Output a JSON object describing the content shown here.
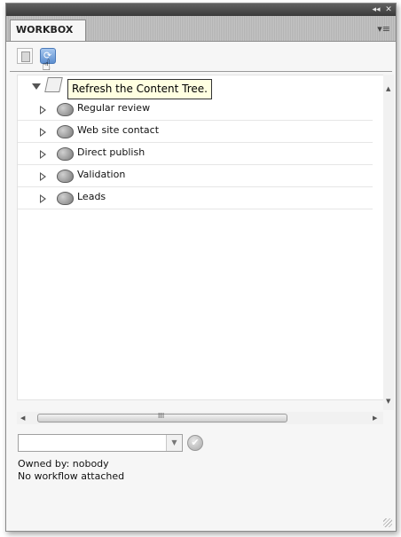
{
  "titlebar": {
    "collapse_glyph": "◂◂",
    "close_glyph": "✕"
  },
  "panel": {
    "tab_label": "WORKBOX",
    "menu_glyph": "▾≡"
  },
  "toolbar": {
    "pdf_icon": "pdf-document-icon",
    "refresh_icon": "refresh-content-tree-icon",
    "cursor_glyph": "☝"
  },
  "tooltip": {
    "text": "Refresh the Content Tree."
  },
  "tree": {
    "root_icon": "folder-icon",
    "items": [
      {
        "label": "Regular review",
        "icon": "workflow-icon"
      },
      {
        "label": "Web site contact",
        "icon": "workflow-icon"
      },
      {
        "label": "Direct publish",
        "icon": "workflow-icon"
      },
      {
        "label": "Validation",
        "icon": "workflow-icon"
      },
      {
        "label": "Leads",
        "icon": "workflow-icon"
      }
    ]
  },
  "scrollbars": {
    "up": "▲",
    "down": "▼",
    "left": "◀",
    "right": "▶",
    "thumb_grip": "III"
  },
  "workflow_select": {
    "value": "",
    "caret": "▼",
    "apply_glyph": "✔"
  },
  "status": {
    "owned_by": "Owned by: nobody",
    "workflow": "No workflow attached"
  }
}
